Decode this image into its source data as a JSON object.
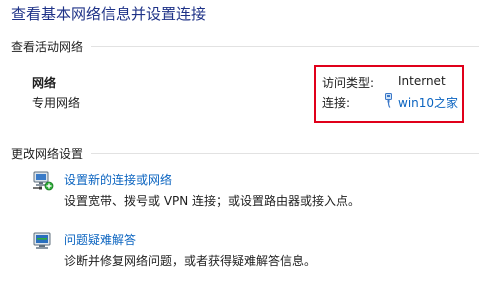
{
  "page_title": "查看基本网络信息并设置连接",
  "active_networks": {
    "heading": "查看活动网络",
    "network_name": "网络",
    "network_type": "专用网络",
    "access_type_label": "访问类型:",
    "access_type_value": "Internet",
    "connection_label": "连接:",
    "connection_value": "win10之家",
    "highlight_color": "#e0001a"
  },
  "change_settings": {
    "heading": "更改网络设置",
    "tasks": [
      {
        "icon": "network-setup-icon",
        "link": "设置新的连接或网络",
        "description": "设置宽带、拨号或 VPN 连接；或设置路由器或接入点。"
      },
      {
        "icon": "troubleshoot-icon",
        "link": "问题疑难解答",
        "description": "诊断并修复网络问题，或者获得疑难解答信息。"
      }
    ]
  },
  "colors": {
    "title": "#1e3287",
    "link": "#0b64c0",
    "text": "#1e1e1e",
    "divider": "#e2e2e2"
  }
}
